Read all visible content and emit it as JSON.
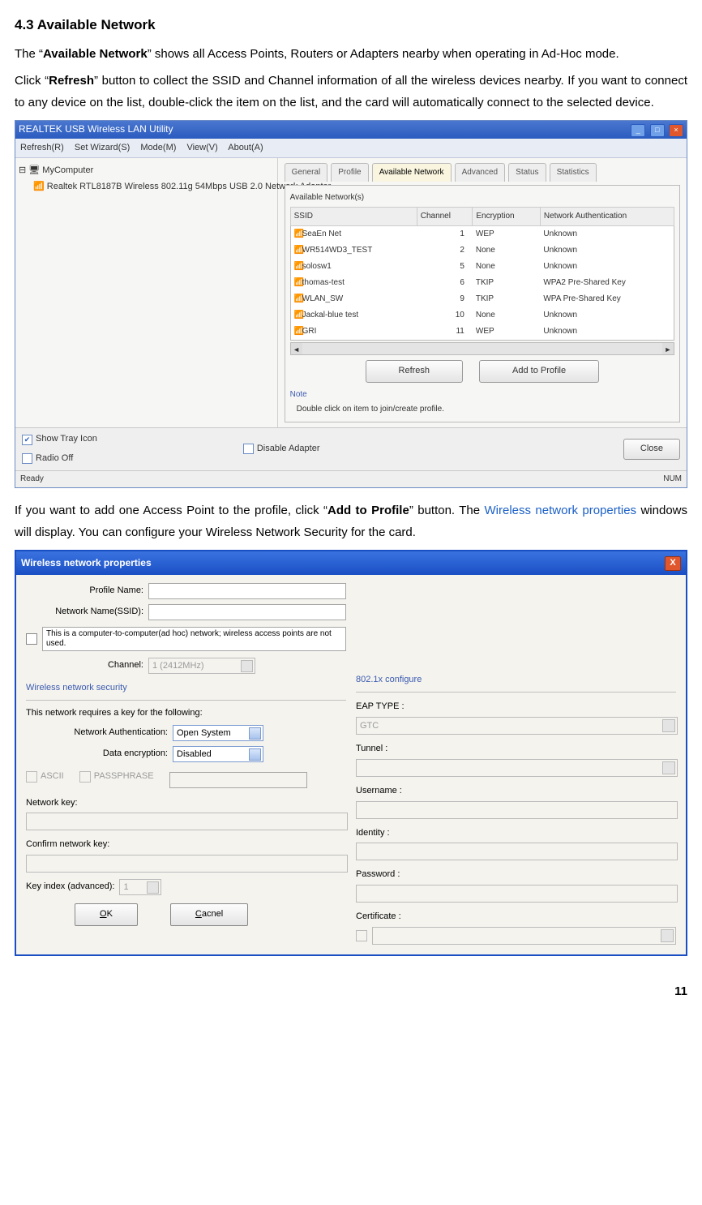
{
  "section": {
    "heading": "4.3  Available Network",
    "p1a": "The “",
    "p1b": "Available Network",
    "p1c": "” shows all Access Points, Routers or Adapters nearby when operating in Ad-Hoc mode.",
    "p2a": "Click “",
    "p2b": "Refresh",
    "p2c": "” button to collect the SSID and Channel information of all the wireless devices nearby. If you want to connect to any device on the list, double-click the item on the list, and the card will automatically connect to the selected device.",
    "p3a": "If you want to add one Access Point to the profile, click “",
    "p3b": "Add to Profile",
    "p3c": "” button. The ",
    "p3d": "Wireless network properties",
    "p3e": " windows will display.   You can configure your Wireless Network Security for the card."
  },
  "lan": {
    "title": "REALTEK USB Wireless LAN Utility",
    "menus": [
      "Refresh(R)",
      "Set Wizard(S)",
      "Mode(M)",
      "View(V)",
      "About(A)"
    ],
    "tree_root": "MyComputer",
    "tree_adapter": "Realtek RTL8187B Wireless 802.11g 54Mbps USB 2.0 Network Adapter",
    "tabs": [
      "General",
      "Profile",
      "Available Network",
      "Advanced",
      "Status",
      "Statistics"
    ],
    "panel_label": "Available Network(s)",
    "columns": [
      "SSID",
      "Channel",
      "Encryption",
      "Network Authentication"
    ],
    "rows": [
      {
        "ssid": "SeaEn Net",
        "ch": "1",
        "enc": "WEP",
        "auth": "Unknown"
      },
      {
        "ssid": "WR514WD3_TEST",
        "ch": "2",
        "enc": "None",
        "auth": "Unknown"
      },
      {
        "ssid": "solosw1",
        "ch": "5",
        "enc": "None",
        "auth": "Unknown"
      },
      {
        "ssid": "thomas-test",
        "ch": "6",
        "enc": "TKIP",
        "auth": "WPA2 Pre-Shared Key"
      },
      {
        "ssid": "WLAN_SW",
        "ch": "9",
        "enc": "TKIP",
        "auth": "WPA Pre-Shared Key"
      },
      {
        "ssid": "Jackal-blue test",
        "ch": "10",
        "enc": "None",
        "auth": "Unknown"
      },
      {
        "ssid": "GRI",
        "ch": "11",
        "enc": "WEP",
        "auth": "Unknown"
      }
    ],
    "refresh_btn": "Refresh",
    "add_btn": "Add to Profile",
    "note_label": "Note",
    "note_text": "Double click on item to join/create profile.",
    "show_tray": "Show Tray Icon",
    "disable_adapter": "Disable Adapter",
    "radio_off": "Radio Off",
    "close": "Close",
    "status_left": "Ready",
    "status_right": "NUM"
  },
  "dlg": {
    "title": "Wireless network properties",
    "profile_name": "Profile Name:",
    "ssid_label": "Network Name(SSID):",
    "adhoc_text": "This is a computer-to-computer(ad hoc) network; wireless access points are not used.",
    "channel_label": "Channel:",
    "channel_value": "1 (2412MHz)",
    "sec_group": "Wireless network security",
    "sec_text": "This network requires a key for the following:",
    "auth_label": "Network Authentication:",
    "auth_value": "Open System",
    "enc_label": "Data encryption:",
    "enc_value": "Disabled",
    "ascii": "ASCII",
    "passphrase": "PASSPHRASE",
    "netkey": "Network key:",
    "confkey": "Confirm network key:",
    "keyidx": "Key index (advanced):",
    "keyidx_val": "1",
    "ok": "OK",
    "cancel": "Cacnel",
    "cfg_group": "802.1x configure",
    "eap": "EAP TYPE :",
    "eap_val": "GTC",
    "tunnel": "Tunnel :",
    "username": "Username :",
    "identity": "Identity :",
    "password": "Password :",
    "cert": "Certificate :"
  },
  "page_number": "11"
}
